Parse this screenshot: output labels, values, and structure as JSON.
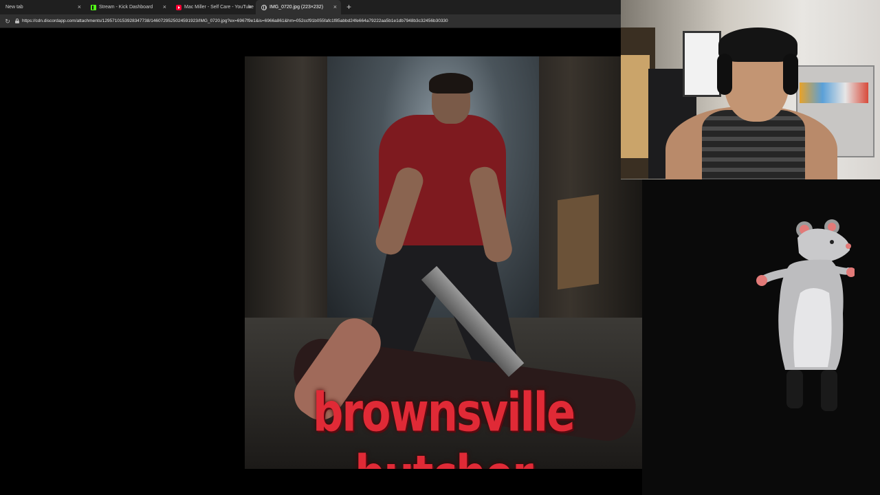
{
  "browser": {
    "tabs": [
      {
        "title": "New tab",
        "favicon": "blank",
        "active": false
      },
      {
        "title": "Stream - Kick Dashboard",
        "favicon": "kick-icon",
        "active": false
      },
      {
        "title": "Mac Miller - Self Care - YouTube",
        "favicon": "youtube-icon",
        "active": false
      },
      {
        "title": "IMG_0720.jpg (223×232)",
        "favicon": "globe-icon",
        "active": true
      }
    ],
    "new_tab_symbol": "+",
    "close_symbol": "×",
    "url": "https://cdn.discordapp.com/attachments/1295710153928347738/1460729525024591923/IMG_0720.jpg?ex=6967f9e1&is=6966a861&hm=052ccf91b055fafc1f85abbd24fe664a79222aa5b1e1db7948b3c32456b30330"
  },
  "poster": {
    "title_text": "brownsville butcher"
  },
  "colors": {
    "tab_bar": "#1f1f1f",
    "active_tab": "#303030",
    "poster_title": "#e02a36",
    "background": "#000000"
  }
}
